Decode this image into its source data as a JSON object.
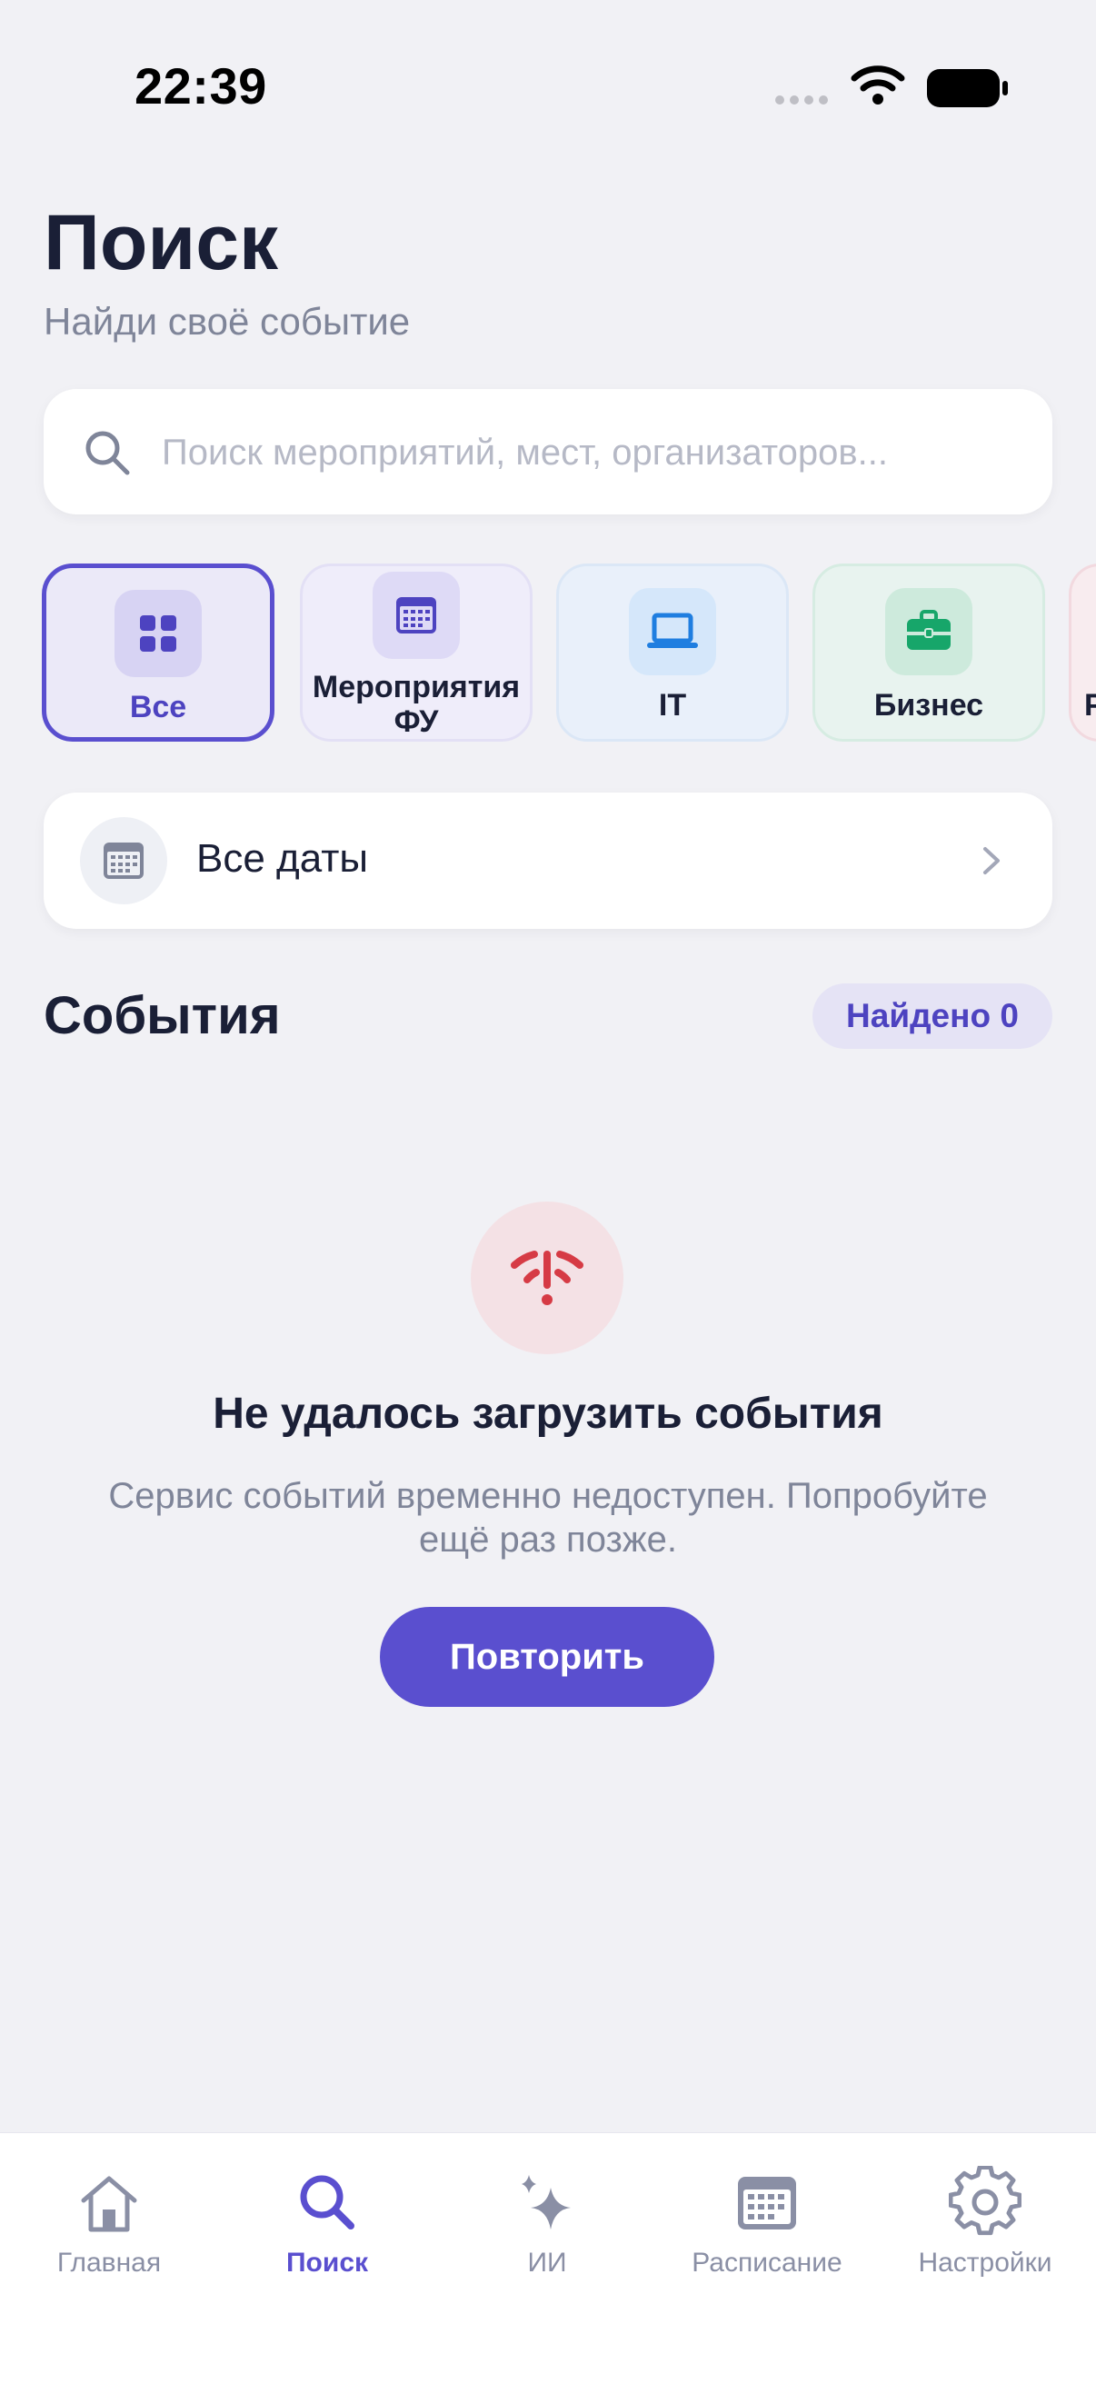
{
  "status_bar": {
    "time": "22:39"
  },
  "header": {
    "title": "Поиск",
    "subtitle": "Найди своё событие"
  },
  "search": {
    "placeholder": "Поиск мероприятий, мест, организаторов..."
  },
  "categories": [
    {
      "label": "Все",
      "icon": "grid-icon",
      "selected": true
    },
    {
      "label": "Мероприятия ФУ",
      "icon": "calendar-icon",
      "selected": false
    },
    {
      "label": "IT",
      "icon": "laptop-icon",
      "selected": false
    },
    {
      "label": "Бизнес",
      "icon": "briefcase-icon",
      "selected": false
    },
    {
      "label": "Р",
      "icon": "",
      "selected": false
    }
  ],
  "date_filter": {
    "label": "Все даты",
    "icon": "calendar-icon"
  },
  "events": {
    "title": "События",
    "found_badge": "Найдено 0"
  },
  "error": {
    "icon": "wifi-off-icon",
    "title": "Не удалось загрузить события",
    "description": "Сервис событий временно недоступен. Попробуйте ещё раз позже.",
    "retry_label": "Повторить"
  },
  "tabs": [
    {
      "label": "Главная",
      "icon": "home-icon"
    },
    {
      "label": "Поиск",
      "icon": "search-icon",
      "active": true
    },
    {
      "label": "ИИ",
      "icon": "sparkles-icon"
    },
    {
      "label": "Расписание",
      "icon": "calendar-icon"
    },
    {
      "label": "Настройки",
      "icon": "gear-icon"
    }
  ],
  "colors": {
    "accent": "#5a4fcf",
    "background": "#f1f1f5",
    "error": "#d63b45",
    "text_primary": "#1a1f36",
    "text_secondary": "#7f8599"
  }
}
